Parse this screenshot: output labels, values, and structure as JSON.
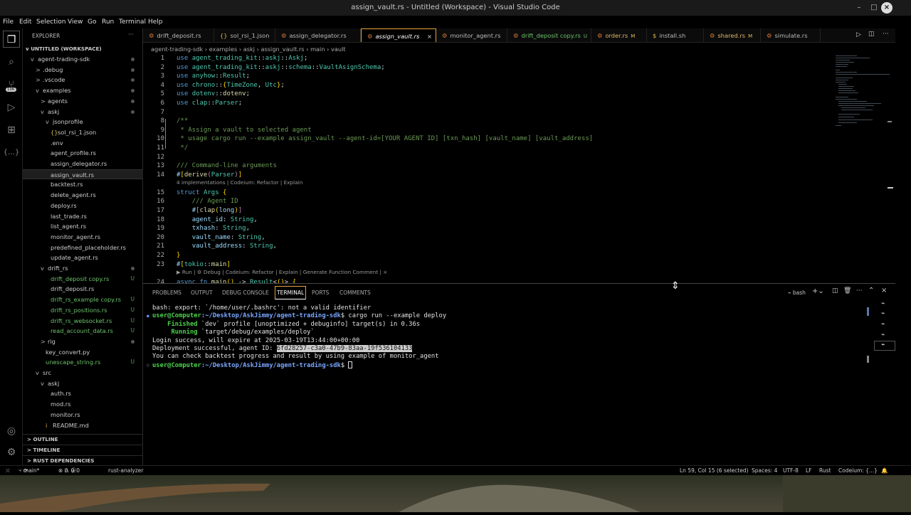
{
  "window": {
    "title": "assign_vault.rs - Untitled (Workspace) - Visual Studio Code"
  },
  "menu": [
    "File",
    "Edit",
    "Selection",
    "View",
    "Go",
    "Run",
    "Terminal",
    "Help"
  ],
  "explorer": {
    "title": "EXPLORER",
    "workspace": "UNTITLED (WORKSPACE)",
    "items": [
      {
        "label": "agent-trading-sdk",
        "indent": 1,
        "chev": "v"
      },
      {
        "label": ".debug",
        "indent": 2,
        "chev": ">"
      },
      {
        "label": ".vscode",
        "indent": 2,
        "chev": ">"
      },
      {
        "label": "examples",
        "indent": 2,
        "chev": "v"
      },
      {
        "label": "agents",
        "indent": 3,
        "chev": ">"
      },
      {
        "label": "askj",
        "indent": 3,
        "chev": "v"
      },
      {
        "label": "jsonprofile",
        "indent": 4,
        "chev": "v"
      },
      {
        "label": "sol_rsi_1.json",
        "indent": 5,
        "chev": "",
        "icon": "{}"
      },
      {
        "label": ".env",
        "indent": 4,
        "chev": ""
      },
      {
        "label": "agent_profile.rs",
        "indent": 4,
        "chev": ""
      },
      {
        "label": "assign_delegator.rs",
        "indent": 4,
        "chev": ""
      },
      {
        "label": "assign_vault.rs",
        "indent": 4,
        "chev": "",
        "selected": true
      },
      {
        "label": "backtest.rs",
        "indent": 4,
        "chev": ""
      },
      {
        "label": "delete_agent.rs",
        "indent": 4,
        "chev": ""
      },
      {
        "label": "deploy.rs",
        "indent": 4,
        "chev": ""
      },
      {
        "label": "last_trade.rs",
        "indent": 4,
        "chev": ""
      },
      {
        "label": "list_agent.rs",
        "indent": 4,
        "chev": ""
      },
      {
        "label": "monitor_agent.rs",
        "indent": 4,
        "chev": ""
      },
      {
        "label": "predefined_placeholder.rs",
        "indent": 4,
        "chev": ""
      },
      {
        "label": "update_agent.rs",
        "indent": 4,
        "chev": ""
      },
      {
        "label": "drift_rs",
        "indent": 3,
        "chev": "v",
        "status": "dot"
      },
      {
        "label": "drift_deposit copy.rs",
        "indent": 4,
        "chev": "",
        "status": "U"
      },
      {
        "label": "drift_deposit.rs",
        "indent": 4,
        "chev": ""
      },
      {
        "label": "drift_rs_example copy.rs",
        "indent": 4,
        "chev": "",
        "status": "U"
      },
      {
        "label": "drift_rs_positions.rs",
        "indent": 4,
        "chev": "",
        "status": "U"
      },
      {
        "label": "drift_rs_websocket.rs",
        "indent": 4,
        "chev": "",
        "status": "U"
      },
      {
        "label": "read_account_data.rs",
        "indent": 4,
        "chev": "",
        "status": "U"
      },
      {
        "label": "rig",
        "indent": 3,
        "chev": ">",
        "status": "dot"
      },
      {
        "label": "key_convert.py",
        "indent": 3,
        "chev": ""
      },
      {
        "label": "unescape_string.rs",
        "indent": 3,
        "chev": "",
        "status": "U"
      },
      {
        "label": "src",
        "indent": 2,
        "chev": "v"
      },
      {
        "label": "askj",
        "indent": 3,
        "chev": "v"
      },
      {
        "label": "auth.rs",
        "indent": 4,
        "chev": ""
      },
      {
        "label": "mod.rs",
        "indent": 4,
        "chev": ""
      },
      {
        "label": "monitor.rs",
        "indent": 4,
        "chev": ""
      },
      {
        "label": "README.md",
        "indent": 4,
        "chev": "",
        "icon": "i"
      }
    ],
    "sections": [
      "OUTLINE",
      "TIMELINE",
      "RUST DEPENDENCIES"
    ]
  },
  "tabs": [
    {
      "label": "drift_deposit.rs",
      "flag": ""
    },
    {
      "label": "sol_rsi_1.json",
      "flag": ""
    },
    {
      "label": "assign_delegator.rs",
      "flag": ""
    },
    {
      "label": "assign_vault.rs",
      "flag": "",
      "active": true
    },
    {
      "label": "monitor_agent.rs",
      "flag": ""
    },
    {
      "label": "drift_deposit copy.rs",
      "flag": "U"
    },
    {
      "label": "order.rs",
      "flag": "M"
    },
    {
      "label": "install.sh",
      "flag": ""
    },
    {
      "label": "shared.rs",
      "flag": "M"
    },
    {
      "label": "simulate.rs",
      "flag": ""
    }
  ],
  "breadcrumb": [
    "agent-trading-sdk",
    "examples",
    "askj",
    "assign_vault.rs",
    "main",
    "vault"
  ],
  "code": [
    {
      "n": "1",
      "html": "<span class='kw'>use</span> <span class='ty'>agent_trading_kit</span>::<span class='ty'>askj</span>::<span class='ty'>Askj</span>;"
    },
    {
      "n": "2",
      "html": "<span class='kw'>use</span> <span class='ty'>agent_trading_kit</span>::<span class='ty'>askj</span>::<span class='ty'>schema</span>::<span class='ty'>VaultAsignSchema</span>;"
    },
    {
      "n": "3",
      "html": "<span class='kw'>use</span> <span class='ty'>anyhow</span>::<span class='ty'>Result</span>;"
    },
    {
      "n": "4",
      "html": "<span class='kw'>use</span> <span class='ty'>chrono</span>::<span class='pu'>{</span><span class='ty'>TimeZone</span>, <span class='ty'>Utc</span><span class='pu'>}</span>;"
    },
    {
      "n": "5",
      "html": "<span class='kw'>use</span> <span class='ty'>dotenv</span>::<span class='fn'>dotenv</span>;"
    },
    {
      "n": "6",
      "html": "<span class='kw'>use</span> <span class='ty'>clap</span>::<span class='ty'>Parser</span>;"
    },
    {
      "n": "7",
      "html": ""
    },
    {
      "n": "8",
      "html": "<span class='cm'>/**</span>"
    },
    {
      "n": "9",
      "html": "<span class='cm'> * Assign a vault to selected agent</span>"
    },
    {
      "n": "10",
      "html": "<span class='cm'> * usage cargo run --example assign_vault --agent-id=[YOUR AGENT ID] [txn_hash] [vault_name] [vault_address]</span>"
    },
    {
      "n": "11",
      "html": "<span class='cm'> */</span>"
    },
    {
      "n": "12",
      "html": ""
    },
    {
      "n": "13",
      "html": "<span class='cm'>/// Command-line arguments</span>"
    },
    {
      "n": "14",
      "html": "<span class='va'>#</span><span class='pu'>[</span><span class='fn'>derive</span><span class='mc'>(</span><span class='ty'>Parser</span><span class='mc'>)</span><span class='pu'>]</span>",
      "lens": "4 implementations | Codeium: Refactor | Explain"
    },
    {
      "n": "15",
      "html": "<span class='kw'>struct</span> <span class='ty'>Args</span> <span class='pu'>{</span>"
    },
    {
      "n": "16",
      "html": "    <span class='cm'>/// Agent ID</span>"
    },
    {
      "n": "17",
      "html": "    <span class='va'>#</span><span class='mc'>[</span><span class='fn'>clap</span><span class='pu'>(</span><span class='va'>long</span><span class='pu'>)</span><span class='mc'>]</span>"
    },
    {
      "n": "18",
      "html": "    <span class='va'>agent_id</span>: <span class='ty'>String</span>,"
    },
    {
      "n": "19",
      "html": "    <span class='va'>txhash</span>: <span class='ty'>String</span>,"
    },
    {
      "n": "20",
      "html": "    <span class='va'>vault_name</span>: <span class='ty'>String</span>,"
    },
    {
      "n": "21",
      "html": "    <span class='va'>vault_address</span>: <span class='ty'>String</span>,"
    },
    {
      "n": "22",
      "html": "<span class='pu'>}</span>"
    },
    {
      "n": "23",
      "html": "<span class='va'>#</span><span class='pu'>[</span><span class='ty'>tokio</span>::<span class='fn'>main</span><span class='pu'>]</span>",
      "lens": "▶ Run | ⚙ Debug | Codeium: Refactor | Explain | Generate Function Comment | ×"
    },
    {
      "n": "24",
      "html": "<span class='kw'>async</span> <span class='kw'>fn</span> <span class='fn'>main</span><span class='pu'>()</span> -&gt; <span class='ty'>Result</span>&lt;<span class='pu'>()</span>&gt; <span class='pu'>{</span>"
    }
  ],
  "panel": {
    "tabs": [
      "PROBLEMS",
      "OUTPUT",
      "DEBUG CONSOLE",
      "TERMINAL",
      "PORTS",
      "COMMENTS"
    ],
    "active": "TERMINAL",
    "shell": "bash"
  },
  "terminal": {
    "l1": "bash: export: `/home/user/.bashrc': not a valid identifier",
    "prompt_user": "user@Computer",
    "prompt_path": ":~/Desktop/AskJimmy/agent-trading-sdk",
    "cmd": "$ cargo run --example deploy",
    "fin_kw": "    Finished",
    "fin_rest": " `dev` profile [unoptimized + debuginfo] target(s) in 0.36s",
    "run_kw": "     Running",
    "run_rest": " `target/debug/examples/deploy`",
    "l5": "Login success, will expire at 2025-03-19T13:44:00+00:00",
    "l6a": "Deployment successful, agent ID: ",
    "l6b": "6fd28257-c3a0-47b9-83aa-19f536104133",
    "l7": "You can check backtest progress and result by using example of monitor_agent",
    "prompt_end": "$ "
  },
  "status": {
    "branch": "main*",
    "errors": "0",
    "warnings": "0",
    "info": "0",
    "analyzer": "rust-analyzer",
    "cursor": "Ln 59, Col 15 (6 selected)",
    "spaces": "Spaces: 4",
    "encoding": "UTF-8",
    "eol": "LF",
    "lang": "Rust",
    "codeium": "Codeium: {...}"
  },
  "activity": {
    "badge": "10K"
  }
}
